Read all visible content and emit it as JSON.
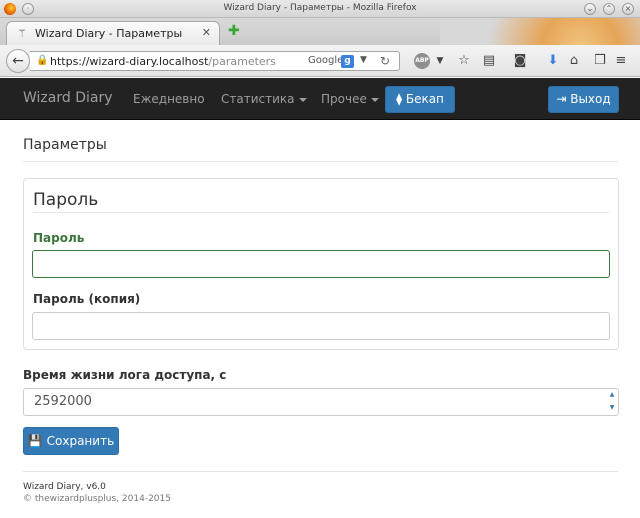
{
  "window": {
    "title": "Wizard Diary - Параметры - Mozilla Firefox"
  },
  "browser": {
    "tab_title": "Wizard Diary - Параметры",
    "url_host": "https://wizard-diary.localhost",
    "url_path": "/parameters",
    "search_engine": "Google",
    "search_badge": "g"
  },
  "app": {
    "brand": "Wizard Diary",
    "nav": {
      "daily": "Ежедневно",
      "stats": "Статистика",
      "other": "Прочее"
    },
    "backup_label": "Бекап",
    "logout_label": "Выход"
  },
  "page": {
    "title": "Параметры",
    "password_section": {
      "legend": "Пароль",
      "password_label": "Пароль",
      "password_value": "",
      "password_copy_label": "Пароль (копия)",
      "password_copy_value": ""
    },
    "log_lifetime_label": "Время жизни лога доступа, с",
    "log_lifetime_value": "2592000",
    "save_label": "Сохранить"
  },
  "footer": {
    "version": "Wizard Diary, v6.0",
    "copyright": "© thewizardplusplus, 2014-2015"
  },
  "colors": {
    "primary": "#337ab7",
    "success": "#3c763d",
    "navbar": "#222222"
  }
}
